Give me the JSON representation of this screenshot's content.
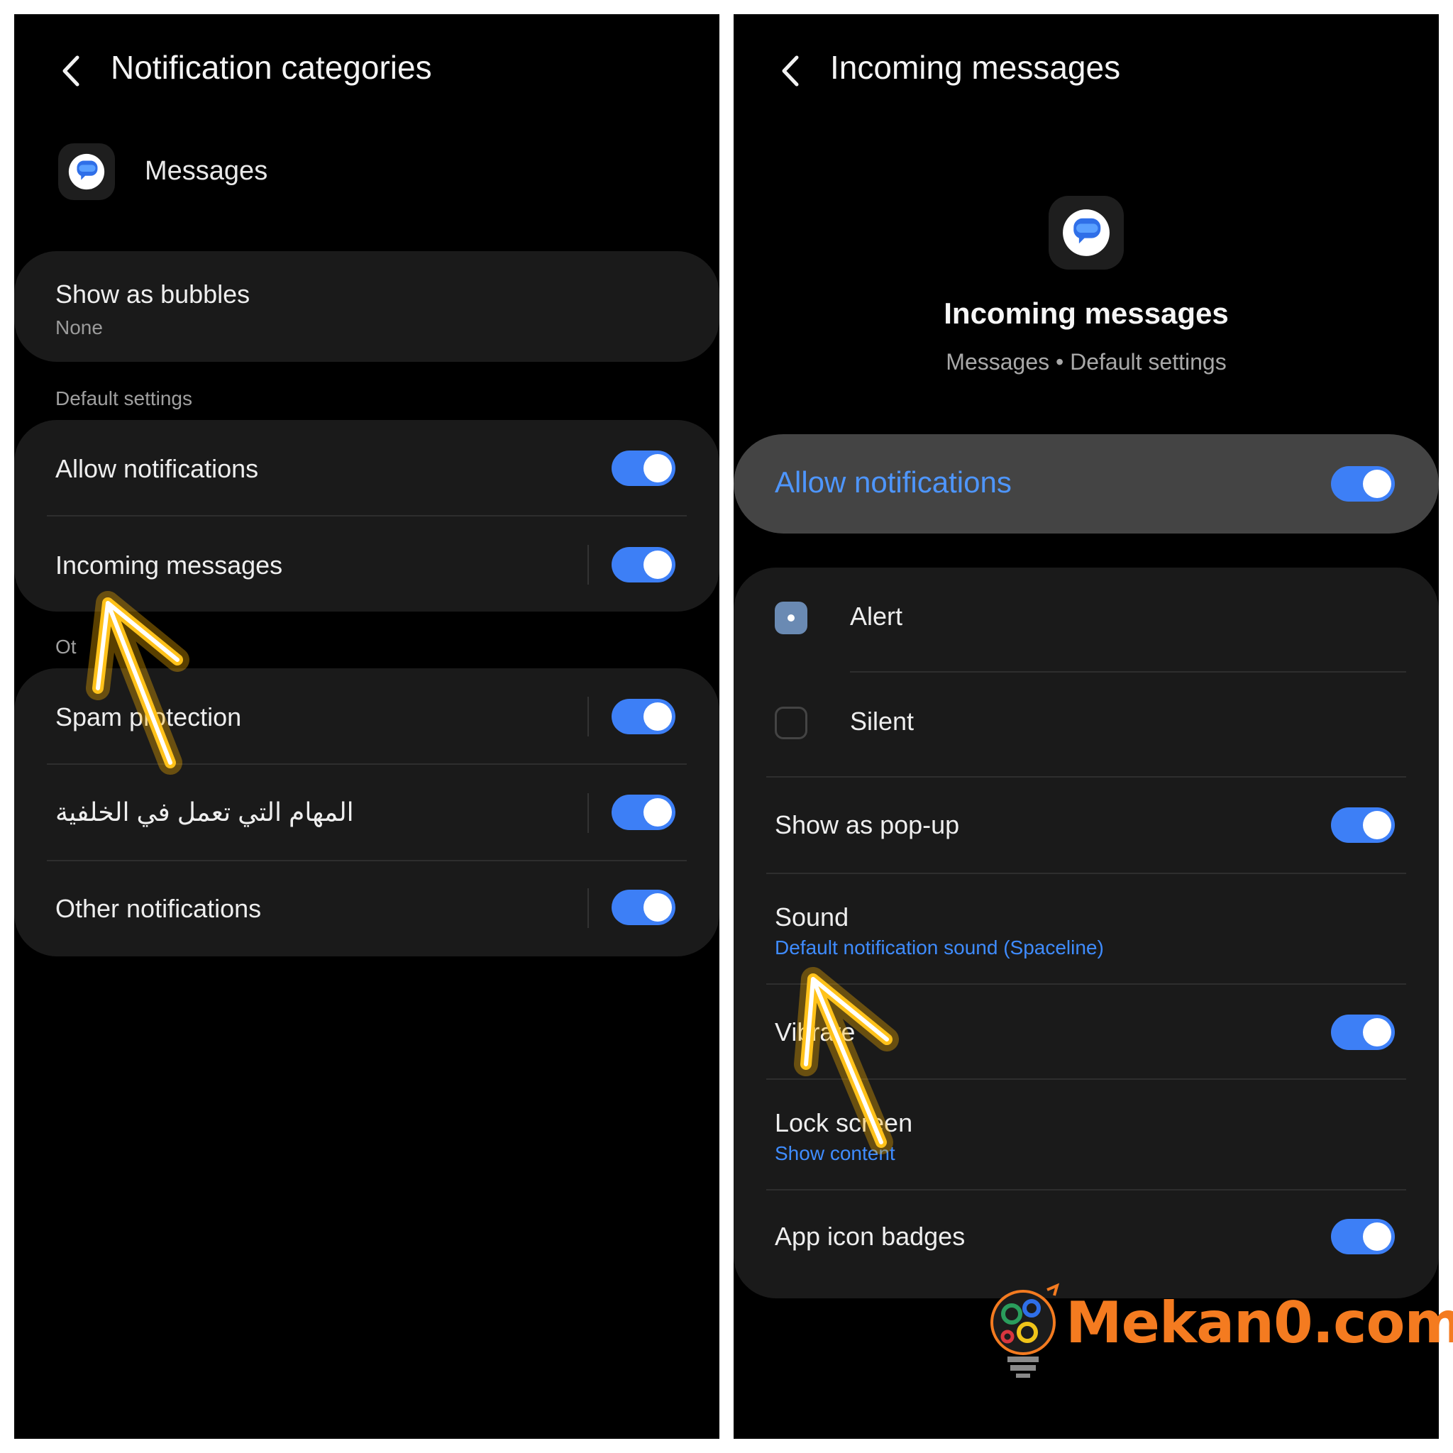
{
  "left": {
    "title": "Notification categories",
    "app_name": "Messages",
    "bubbles": {
      "label": "Show as bubbles",
      "value": "None"
    },
    "section_default": "Default settings",
    "default_items": [
      {
        "label": "Allow notifications",
        "on": true
      },
      {
        "label": "Incoming messages",
        "on": true
      }
    ],
    "section_other": "Ot",
    "other_items": [
      {
        "label": "Spam protection",
        "on": true
      },
      {
        "label": "المهام التي تعمل في الخلفية",
        "on": true
      },
      {
        "label": "Other notifications",
        "on": true
      }
    ]
  },
  "right": {
    "title": "Incoming messages",
    "hero_title": "Incoming messages",
    "hero_sub": "Messages • Default settings",
    "allow": {
      "label": "Allow notifications",
      "on": true
    },
    "mode_options": [
      {
        "label": "Alert",
        "selected": true
      },
      {
        "label": "Silent",
        "selected": false
      }
    ],
    "popup": {
      "label": "Show as pop-up",
      "on": true
    },
    "sound": {
      "label": "Sound",
      "value": "Default notification sound (Spaceline)"
    },
    "vibrate": {
      "label": "Vibrate",
      "on": true
    },
    "lock": {
      "label": "Lock screen",
      "value": "Show content"
    },
    "badges": {
      "label": "App icon badges",
      "on": true
    }
  },
  "watermark": {
    "text": "Mekan0.com"
  },
  "colors": {
    "toggle_on": "#3d7ff6",
    "accent_blue": "#4e96ff",
    "card_bg": "#1a1a1a",
    "highlight_bg": "#444444",
    "arrow": "#ffc21a",
    "watermark": "#f47b20"
  }
}
